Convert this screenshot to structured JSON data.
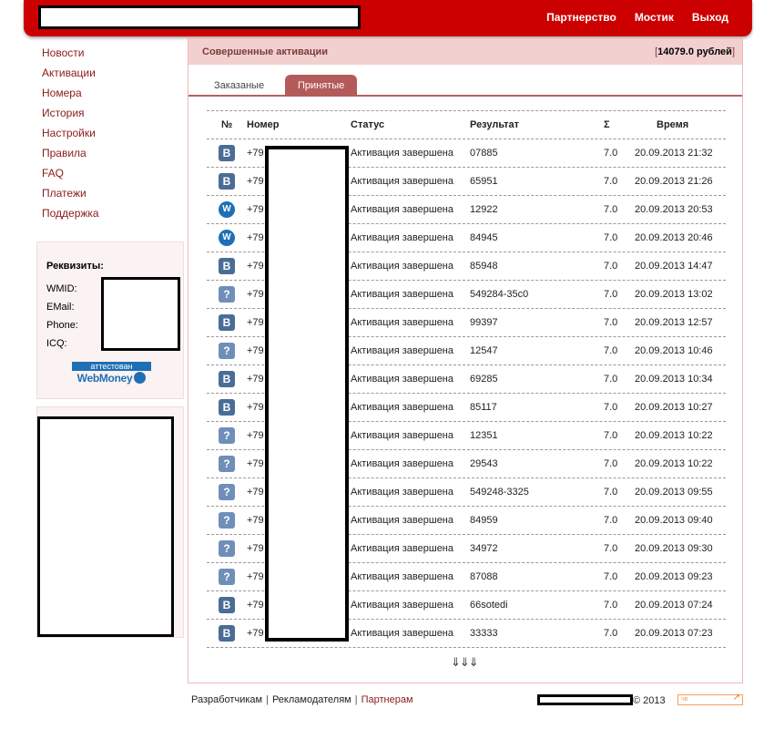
{
  "header": {
    "nav": [
      "Партнерство",
      "Мостик",
      "Выход"
    ]
  },
  "sidebar": {
    "items": [
      "Новости",
      "Активации",
      "Номера",
      "История",
      "Настройки",
      "Правила",
      "FAQ",
      "Платежи",
      "Поддержка"
    ]
  },
  "requisites": {
    "title": "Реквизиты:",
    "wmid_label": "WMID:",
    "email_label": "EMail:",
    "phone_label": "Phone:",
    "icq_label": "ICQ:",
    "badge_top": "аттестован",
    "badge_bottom": "WebMoney"
  },
  "main": {
    "title": "Совершенные активации",
    "balance_open": "[",
    "balance": "14079.0 рублей",
    "balance_close": "]",
    "tabs": [
      "Заказаные",
      "Принятые"
    ],
    "active_tab": "Принятые"
  },
  "table": {
    "headers": [
      "№",
      "Номер",
      "Статус",
      "Результат",
      "Σ",
      "Время"
    ],
    "rows": [
      {
        "icon": "vk",
        "number": "+79",
        "status": "Активация завершена",
        "result": "07885",
        "sum": "7.0",
        "time": "20.09.2013 21:32"
      },
      {
        "icon": "vk",
        "number": "+79",
        "status": "Активация завершена",
        "result": "65951",
        "sum": "7.0",
        "time": "20.09.2013 21:26"
      },
      {
        "icon": "webmoney",
        "number": "+79",
        "status": "Активация завершена",
        "result": "12922",
        "sum": "7.0",
        "time": "20.09.2013 20:53"
      },
      {
        "icon": "webmoney",
        "number": "+79",
        "status": "Активация завершена",
        "result": "84945",
        "sum": "7.0",
        "time": "20.09.2013 20:46"
      },
      {
        "icon": "vk",
        "number": "+79",
        "status": "Активация завершена",
        "result": "85948",
        "sum": "7.0",
        "time": "20.09.2013 14:47"
      },
      {
        "icon": "question",
        "number": "+79",
        "status": "Активация завершена",
        "result": "549284-35c0",
        "sum": "7.0",
        "time": "20.09.2013 13:02"
      },
      {
        "icon": "vk",
        "number": "+79",
        "status": "Активация завершена",
        "result": "99397",
        "sum": "7.0",
        "time": "20.09.2013 12:57"
      },
      {
        "icon": "question",
        "number": "+79",
        "status": "Активация завершена",
        "result": "12547",
        "sum": "7.0",
        "time": "20.09.2013 10:46"
      },
      {
        "icon": "vk",
        "number": "+79",
        "status": "Активация завершена",
        "result": "69285",
        "sum": "7.0",
        "time": "20.09.2013 10:34"
      },
      {
        "icon": "vk",
        "number": "+79",
        "status": "Активация завершена",
        "result": "85117",
        "sum": "7.0",
        "time": "20.09.2013 10:27"
      },
      {
        "icon": "question",
        "number": "+79",
        "status": "Активация завершена",
        "result": "12351",
        "sum": "7.0",
        "time": "20.09.2013 10:22"
      },
      {
        "icon": "question",
        "number": "+79",
        "status": "Активация завершена",
        "result": "29543",
        "sum": "7.0",
        "time": "20.09.2013 10:22"
      },
      {
        "icon": "question",
        "number": "+79",
        "status": "Активация завершена",
        "result": "549248-3325",
        "sum": "7.0",
        "time": "20.09.2013 09:55"
      },
      {
        "icon": "question",
        "number": "+79",
        "status": "Активация завершена",
        "result": "84959",
        "sum": "7.0",
        "time": "20.09.2013 09:40"
      },
      {
        "icon": "question",
        "number": "+79",
        "status": "Активация завершена",
        "result": "34972",
        "sum": "7.0",
        "time": "20.09.2013 09:30"
      },
      {
        "icon": "question",
        "number": "+79",
        "status": "Активация завершена",
        "result": "87088",
        "sum": "7.0",
        "time": "20.09.2013 09:23"
      },
      {
        "icon": "vk",
        "number": "+79",
        "status": "Активация завершена",
        "result": "66sotedi",
        "sum": "7.0",
        "time": "20.09.2013 07:24"
      },
      {
        "icon": "vk",
        "number": "+79",
        "status": "Активация завершена",
        "result": "33333",
        "sum": "7.0",
        "time": "20.09.2013 07:23"
      }
    ],
    "more_arrows": "⇓⇓⇓"
  },
  "footer": {
    "links": [
      "Разработчикам",
      "Рекламодателям",
      "Партнерам"
    ],
    "separator": "|",
    "copyright": "© 2013",
    "counter_label": "чв"
  },
  "colors": {
    "header_bg": "#cc0000",
    "panel_head_bg": "#f3d0d0",
    "active_tab_bg": "#b55a5a",
    "link_color": "#8b1a1a",
    "vk_icon": "#4a6d96",
    "webmoney_blue": "#1f6fb5"
  }
}
